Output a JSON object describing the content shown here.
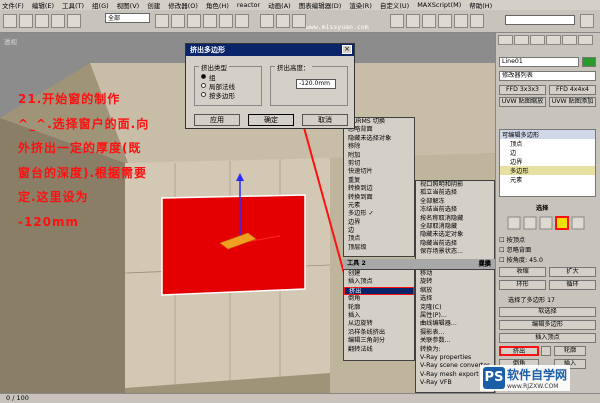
{
  "menubar": {
    "items": [
      "文件(F)",
      "编辑(E)",
      "工具(T)",
      "组(G)",
      "视图(V)",
      "创建",
      "修改器(O)",
      "角色(H)",
      "reactor",
      "动画(A)",
      "图表编辑器(D)",
      "渲染(R)",
      "自定义(U)",
      "MAXScript(M)",
      "帮助(H)"
    ]
  },
  "toolbar": {
    "filter_value": "全部",
    "watermark": "www.missyuan.com"
  },
  "viewport": {
    "label": "透视",
    "tutorial_text": "21.开始窗的制作^_^.选择窗户的面.向外挤出一定的厚度(既窗台的深度).根据需要定.这里设为 -120mm"
  },
  "dialog": {
    "title": "挤出多边形",
    "group_label": "挤出类型",
    "options": [
      "组",
      "局部法线",
      "按多边形"
    ],
    "height_label": "挤出高度：",
    "height_value": "-120.0mm",
    "apply": "应用",
    "ok": "确定",
    "cancel": "取消"
  },
  "quad_menu": {
    "upper_left": [
      "视口照明和阴影",
      "孤立当前选择",
      "全部解冻",
      "冻结当前选择",
      "按名称取消隐藏",
      "全部取消隐藏",
      "隐藏未选定对象",
      "隐藏当前选择",
      "保存场景状态...",
      "管理场景状态..."
    ],
    "upper_left_title": "显示",
    "upper_right": [
      "NURMS 切换",
      "忽略背面",
      "隐藏未选择对象",
      "移除",
      "附加",
      "剪切",
      "快速切片",
      "重复",
      "转换到边",
      "转换到面",
      "元素",
      "多边形",
      "边界",
      "边",
      "顶点",
      "顶层级"
    ],
    "upper_right_check": "多边形",
    "upper_right_title": "工具 1",
    "lower_left_title": "工具 2",
    "lower_left": [
      "创建",
      "插入顶点",
      "挤出",
      "倒角",
      "轮廓",
      "插入",
      "从边旋转",
      "沿样条线挤出",
      "编辑三角剖分",
      "翻转法线"
    ],
    "lower_left_highlight": "挤出",
    "lower_right_title": "变换",
    "lower_right": [
      "移动",
      "旋转",
      "缩放",
      "选择",
      "克隆(C)",
      "属性(P)...",
      "曲线编辑器...",
      "摄影表...",
      "关联参数...",
      "转换为:",
      "V-Ray properties",
      "V-Ray scene converter",
      "V-Ray mesh export",
      "V-Ray VFB"
    ]
  },
  "right_panel": {
    "object_name": "Line01",
    "modifier_list": "修改器列表",
    "buttons_row1": [
      "FFD 3x3x3",
      "FFD 4x4x4"
    ],
    "buttons_row2": [
      "UVW 贴图缩放",
      "UVW 贴图添加"
    ],
    "stack_title": "可编辑多边形",
    "stack_items": [
      "顶点",
      "边",
      "边界",
      "多边形",
      "元素"
    ],
    "select_title": "选择",
    "options": [
      "按顶点",
      "忽略背面",
      "按角度:"
    ],
    "angle_value": "45.0",
    "shrink": "收缩",
    "grow": "扩大",
    "ring": "环形",
    "loop": "循环",
    "selected_info": "选择了多边形 17",
    "soft_select": "软选择",
    "edit_poly_title": "编辑多边形",
    "insert_vertex": "插入顶点",
    "extrude": "挤出",
    "outline": "轮廓",
    "bevel": "倒角",
    "inset": "插入"
  },
  "statusbar": {
    "frame": "0 / 100"
  },
  "logo": {
    "badge": "PS",
    "text": "软件自学网",
    "url": "www.RJZXW.COM"
  },
  "colors": {
    "face": "#e40000",
    "wall": "#d2c8b4",
    "floor": "#b4a68a",
    "annotation": "#ff1010"
  }
}
